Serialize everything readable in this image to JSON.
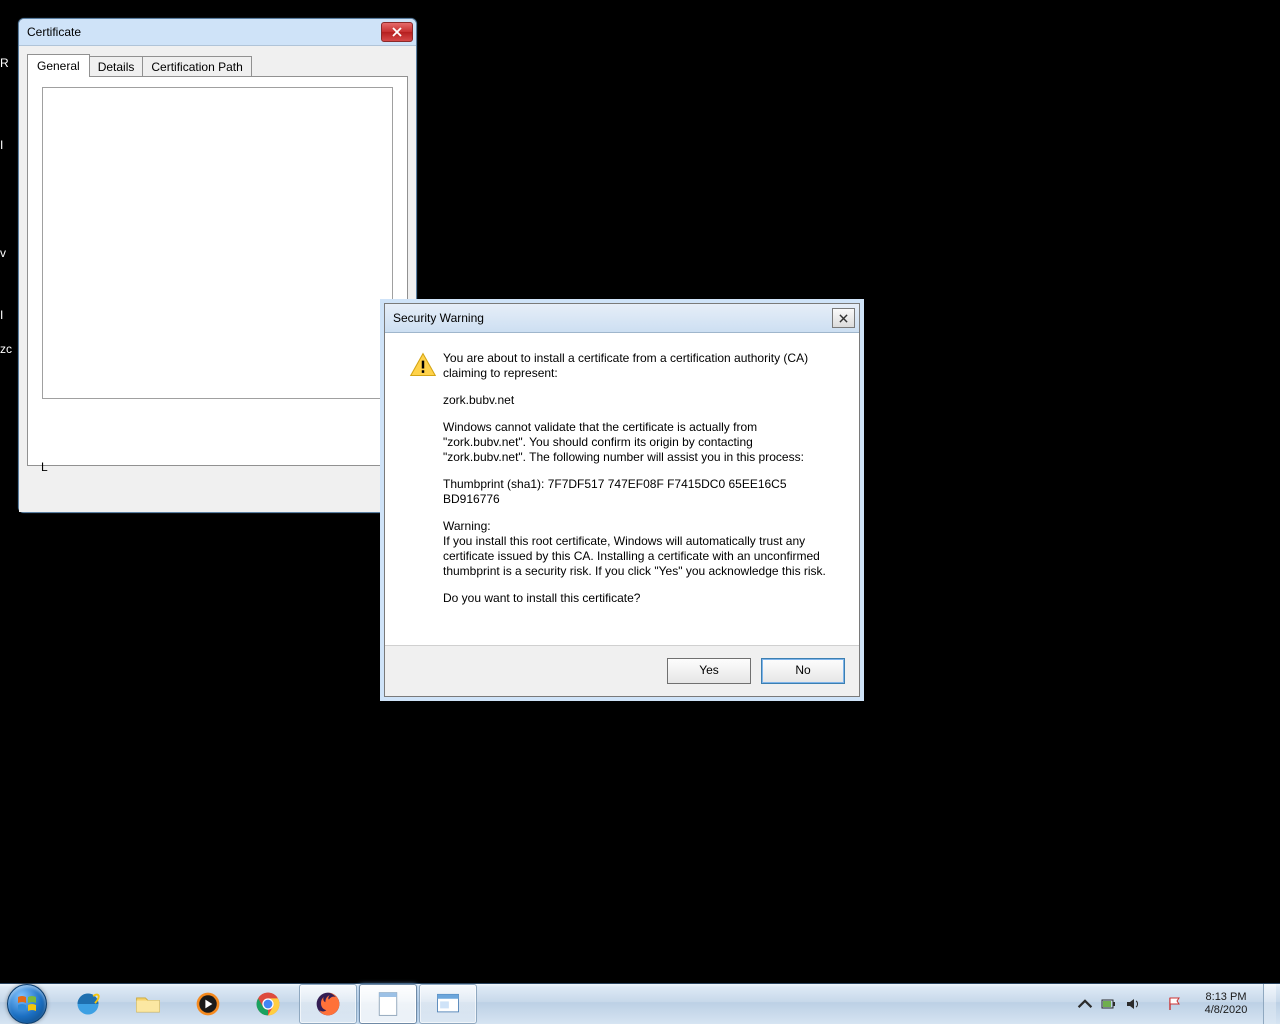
{
  "desktop_labels": {
    "a": "R",
    "b": "I",
    "c": "v",
    "d": "I",
    "e": "zc"
  },
  "cert_dialog": {
    "title": "Certificate",
    "tabs": {
      "general": "General",
      "details": "Details",
      "path": "Certification Path"
    },
    "learn_more_prefix": "L"
  },
  "warning_dialog": {
    "title": "Security Warning",
    "p1": "You are about to install a certificate from a certification authority (CA) claiming to represent:",
    "domain": "zork.bubv.net",
    "p2": "Windows cannot validate that the certificate is actually from \"zork.bubv.net\". You should confirm its origin by contacting \"zork.bubv.net\". The following number will assist you in this process:",
    "thumbprint": "Thumbprint (sha1): 7F7DF517 747EF08F F7415DC0 65EE16C5 BD916776",
    "warning_header": "Warning:",
    "warning_body": "If you install this root certificate, Windows will automatically trust any certificate issued by this CA. Installing a certificate with an unconfirmed thumbprint is a security risk. If you click \"Yes\" you acknowledge this risk.",
    "question": "Do you want to install this certificate?",
    "yes": "Yes",
    "no": "No"
  },
  "taskbar": {
    "time": "8:13 PM",
    "date": "4/8/2020"
  }
}
